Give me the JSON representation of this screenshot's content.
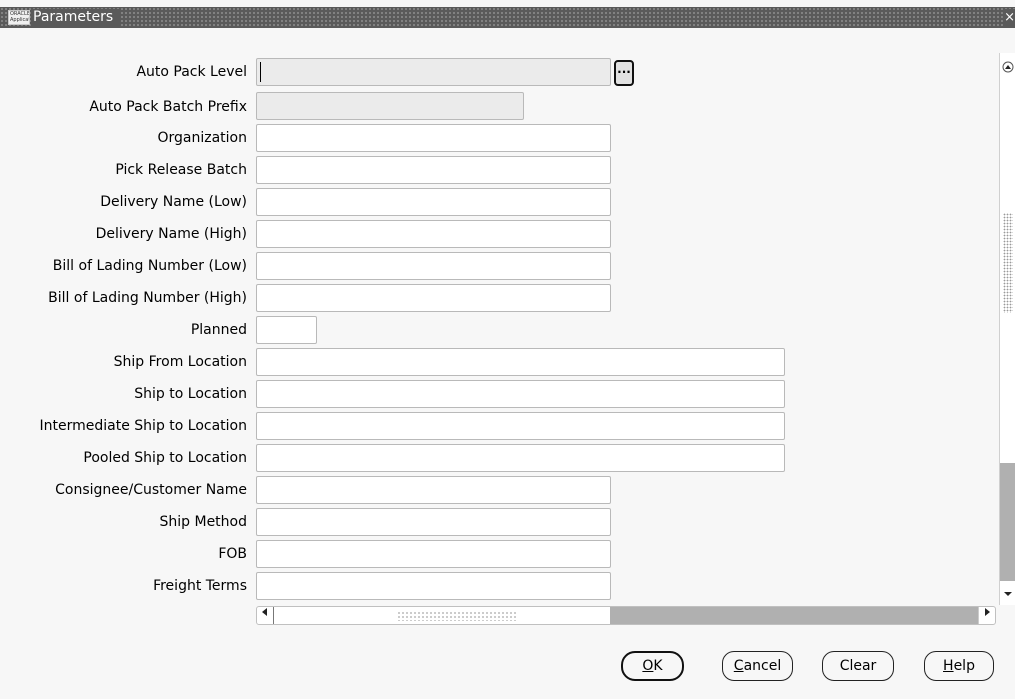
{
  "window": {
    "title": "Parameters",
    "logo_text": "ORACLE Applications",
    "close_glyph": "×"
  },
  "form": {
    "fields": [
      {
        "label": "Auto Pack Level",
        "value": "",
        "readonly": true,
        "lov": true
      },
      {
        "label": "Auto Pack Batch Prefix",
        "value": "",
        "readonly": true
      },
      {
        "label": "Organization",
        "value": ""
      },
      {
        "label": "Pick Release Batch",
        "value": ""
      },
      {
        "label": "Delivery Name (Low)",
        "value": ""
      },
      {
        "label": "Delivery Name (High)",
        "value": ""
      },
      {
        "label": "Bill of Lading Number (Low)",
        "value": ""
      },
      {
        "label": "Bill of Lading Number (High)",
        "value": ""
      },
      {
        "label": "Planned",
        "value": ""
      },
      {
        "label": "Ship From Location",
        "value": ""
      },
      {
        "label": "Ship to Location",
        "value": ""
      },
      {
        "label": "Intermediate Ship to Location",
        "value": ""
      },
      {
        "label": "Pooled Ship to Location",
        "value": ""
      },
      {
        "label": "Consignee/Customer Name",
        "value": ""
      },
      {
        "label": "Ship Method",
        "value": ""
      },
      {
        "label": "FOB",
        "value": ""
      },
      {
        "label": "Freight Terms",
        "value": ""
      }
    ],
    "lov_button_label": "..."
  },
  "buttons": {
    "ok": {
      "mnemonic": "O",
      "rest": "K"
    },
    "cancel": {
      "mnemonic": "C",
      "rest": "ancel"
    },
    "clear": {
      "label": "Clear"
    },
    "help": {
      "mnemonic": "H",
      "rest": "elp"
    }
  },
  "icons": {
    "lov": "ellipsis-icon",
    "scroll_up": "arrow-up-icon",
    "scroll_down": "arrow-down-icon",
    "scroll_left": "arrow-left-icon",
    "scroll_right": "arrow-right-icon"
  },
  "colors": {
    "titlebar": "#5a5a5a",
    "background": "#f7f7f7",
    "readonly_field": "#ebebeb",
    "scroll_track": "#b0b0b0"
  }
}
